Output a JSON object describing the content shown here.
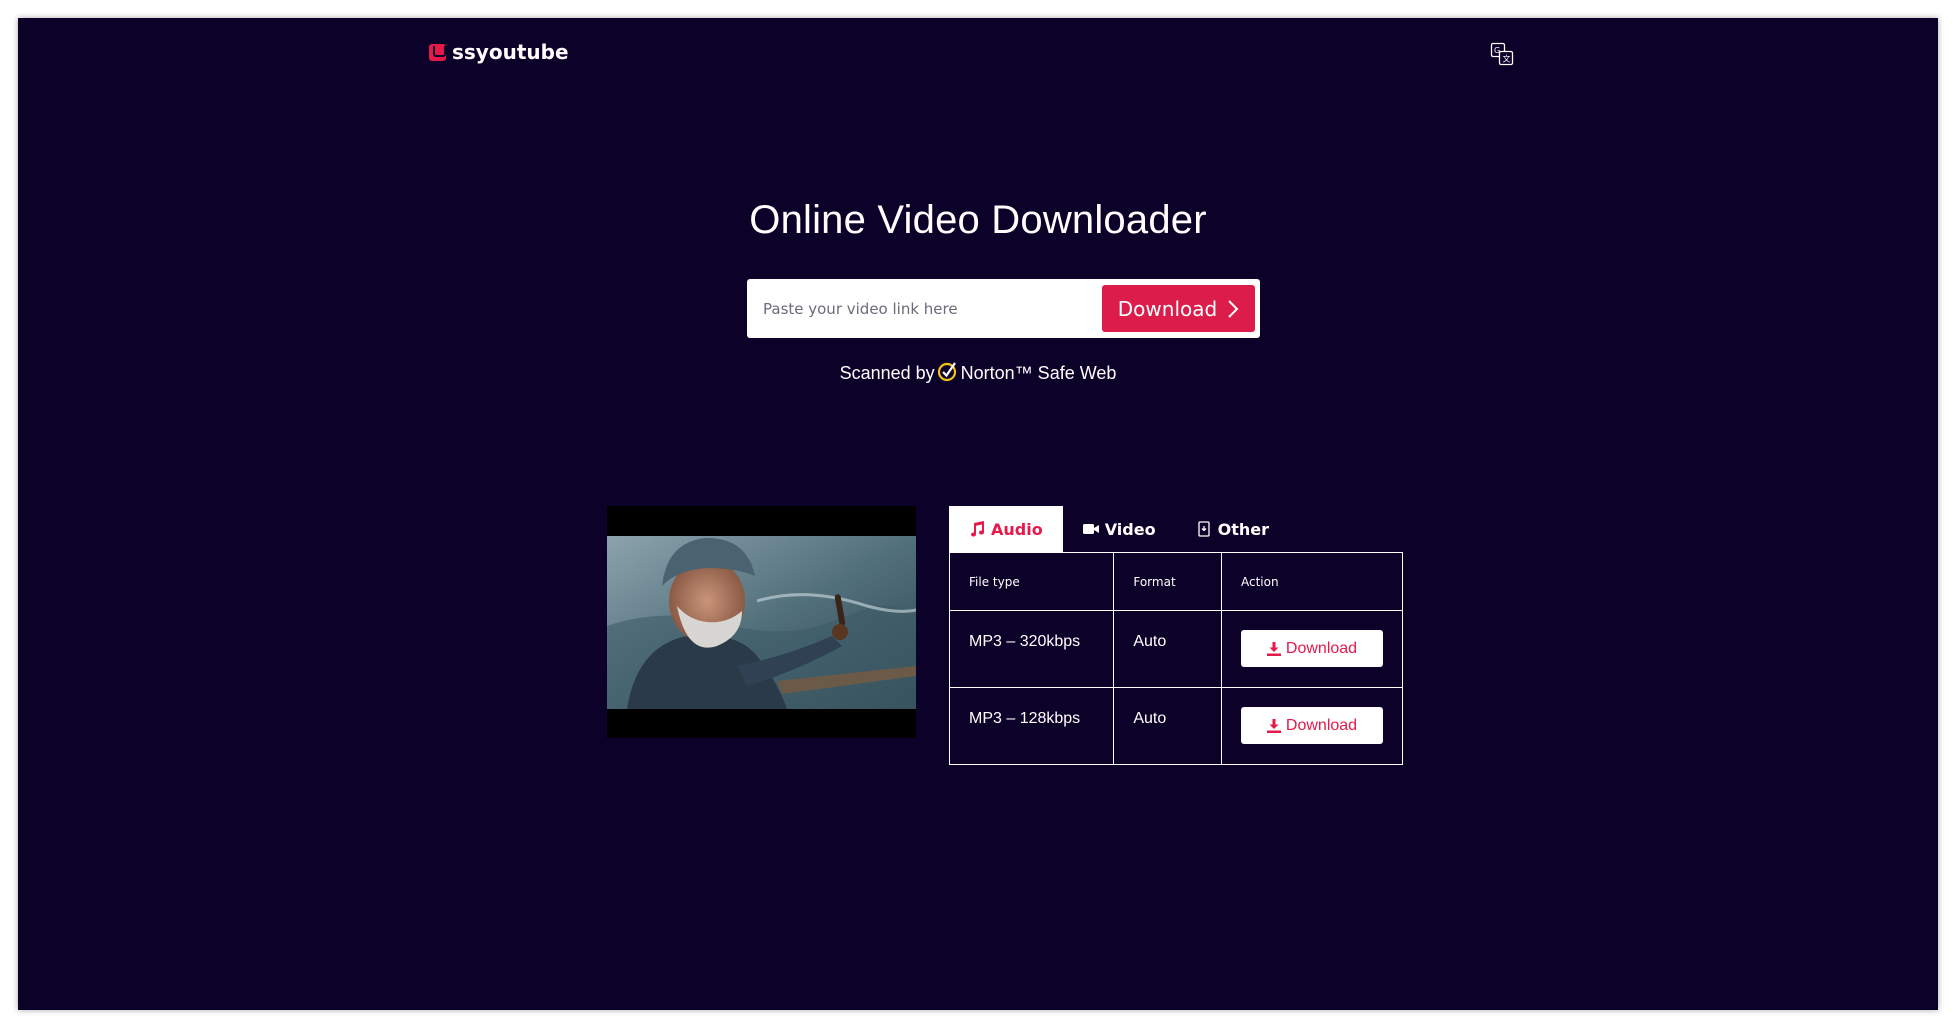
{
  "header": {
    "logo_text": "ssyoutube",
    "language_icon": "translate-icon"
  },
  "hero": {
    "title": "Online Video Downloader",
    "search_placeholder": "Paste your video link here",
    "download_label": "Download",
    "scanned_prefix": "Scanned by",
    "scanned_brand": "Norton™ Safe Web"
  },
  "result": {
    "tabs": [
      {
        "label": "Audio",
        "icon": "music-note-icon",
        "active": true
      },
      {
        "label": "Video",
        "icon": "video-camera-icon",
        "active": false
      },
      {
        "label": "Other",
        "icon": "file-icon",
        "active": false
      }
    ],
    "table": {
      "headers": [
        "File type",
        "Format",
        "Action"
      ],
      "rows": [
        {
          "file_type": "MP3 – 320kbps",
          "format": "Auto",
          "action": "Download"
        },
        {
          "file_type": "MP3 – 128kbps",
          "format": "Auto",
          "action": "Download"
        }
      ]
    }
  },
  "colors": {
    "background": "#0c0128",
    "accent": "#dc1c4b",
    "tab_active_text": "#e5194a"
  }
}
